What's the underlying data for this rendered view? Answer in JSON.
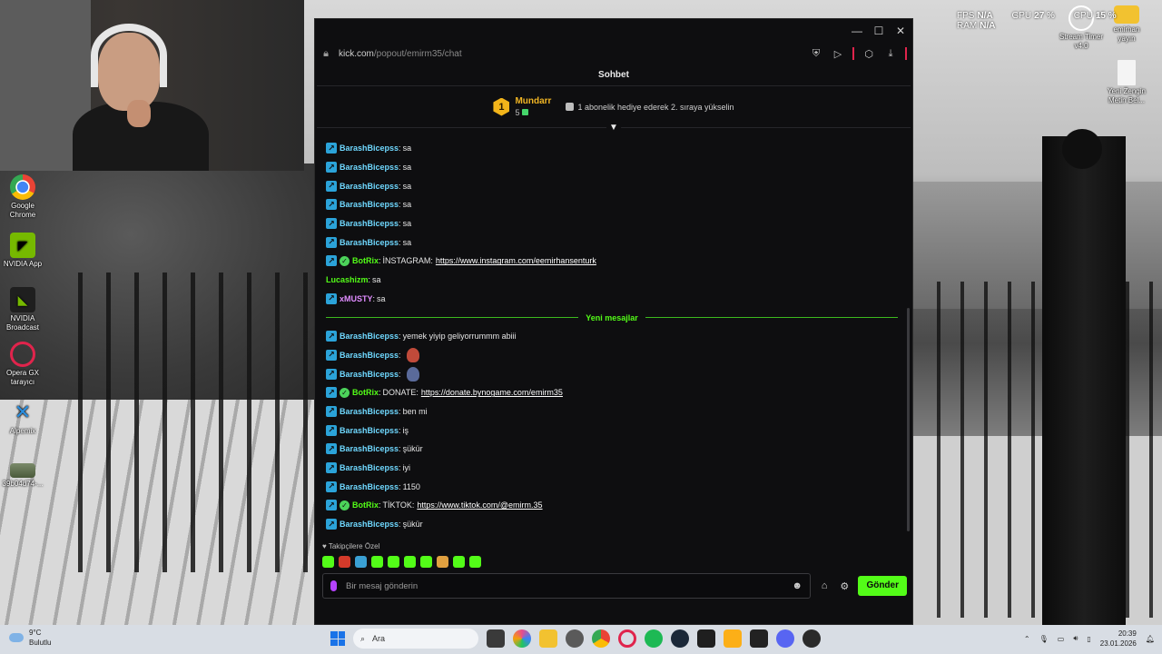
{
  "desktop": {
    "icons": [
      {
        "label": "Google Chrome"
      },
      {
        "label": "NVIDIA App"
      },
      {
        "label": "NVIDIA Broadcast"
      },
      {
        "label": "Opera GX tarayıcı"
      },
      {
        "label": "Alpemix"
      },
      {
        "label": "39b04d74-..."
      },
      {
        "label": "Stream Timer v4.0"
      },
      {
        "label": "emirhan yayın"
      },
      {
        "label": "Yeni Zengin Metin Bel..."
      }
    ],
    "overlay": {
      "fps_label": "FPS",
      "fps_value": "N/A",
      "gpu_label": "GPU",
      "gpu_value": "27 %",
      "cpu_label": "CPU",
      "cpu_value": "15 %",
      "ram_label": "RAM",
      "ram_value": "N/A"
    }
  },
  "browser": {
    "url_host": "kick.com",
    "url_path": "/popout/emirm35/chat",
    "chat_title": "Sohbet",
    "leader": {
      "rank": "1",
      "name": "Mundarr",
      "count": "5",
      "hint": "1 abonelik hediye ederek 2. sıraya yükselin"
    },
    "messages": [
      {
        "user": "BarashBicepss",
        "color": "#6fd8ff",
        "badge": "kick",
        "text": "sa"
      },
      {
        "user": "BarashBicepss",
        "color": "#6fd8ff",
        "badge": "kick",
        "text": "sa"
      },
      {
        "user": "BarashBicepss",
        "color": "#6fd8ff",
        "badge": "kick",
        "text": "sa"
      },
      {
        "user": "BarashBicepss",
        "color": "#6fd8ff",
        "badge": "kick",
        "text": "sa"
      },
      {
        "user": "BarashBicepss",
        "color": "#6fd8ff",
        "badge": "kick",
        "text": "sa"
      },
      {
        "user": "BarashBicepss",
        "color": "#6fd8ff",
        "badge": "kick",
        "text": "sa"
      },
      {
        "user": "BotRix",
        "color": "#53fc18",
        "badge": "bot",
        "text": "İNSTAGRAM:",
        "link": "https://www.instagram.com/eemirhansenturk"
      },
      {
        "user": "Lucashizm",
        "color": "#53fc18",
        "badge": "none",
        "text": "sa"
      },
      {
        "user": "xMUSTY",
        "color": "#e08cff",
        "badge": "kick",
        "text": "sa"
      }
    ],
    "new_messages_label": "Yeni mesajlar",
    "new_messages": [
      {
        "user": "BarashBicepss",
        "color": "#6fd8ff",
        "badge": "kick",
        "text": "yemek yiyip geliyorrummm abiii"
      },
      {
        "user": "BarashBicepss",
        "color": "#6fd8ff",
        "badge": "kick",
        "text": "",
        "emote": "#c04a3a"
      },
      {
        "user": "BarashBicepss",
        "color": "#6fd8ff",
        "badge": "kick",
        "text": "",
        "emote": "#5a6a9a"
      },
      {
        "user": "BotRix",
        "color": "#53fc18",
        "badge": "bot",
        "text": "DONATE:",
        "link": "https://donate.bynogame.com/emirm35"
      },
      {
        "user": "BarashBicepss",
        "color": "#6fd8ff",
        "badge": "kick",
        "text": "ben mi"
      },
      {
        "user": "BarashBicepss",
        "color": "#6fd8ff",
        "badge": "kick",
        "text": "iş"
      },
      {
        "user": "BarashBicepss",
        "color": "#6fd8ff",
        "badge": "kick",
        "text": "şükür"
      },
      {
        "user": "BarashBicepss",
        "color": "#6fd8ff",
        "badge": "kick",
        "text": "iyi"
      },
      {
        "user": "BarashBicepss",
        "color": "#6fd8ff",
        "badge": "kick",
        "text": "1150"
      },
      {
        "user": "BotRix",
        "color": "#53fc18",
        "badge": "bot",
        "text": "TİKTOK:",
        "link": "https://www.tiktok.com/@emirm.35"
      },
      {
        "user": "BarashBicepss",
        "color": "#6fd8ff",
        "badge": "kick",
        "text": "şükür"
      }
    ],
    "emote_section_title": "Takipçilere Özel",
    "emote_colors": [
      "#53fc18",
      "#d43a2a",
      "#3aa0d4",
      "#53fc18",
      "#53fc18",
      "#53fc18",
      "#53fc18",
      "#e0a040",
      "#53fc18",
      "#53fc18"
    ],
    "input_placeholder": "Bir mesaj gönderin",
    "send_label": "Gönder"
  },
  "taskbar": {
    "temperature": "9°C",
    "weather": "Bulutlu",
    "search_label": "Ara",
    "time": "20:39",
    "date": "23.01.2026",
    "accent": "#1a73e8"
  }
}
